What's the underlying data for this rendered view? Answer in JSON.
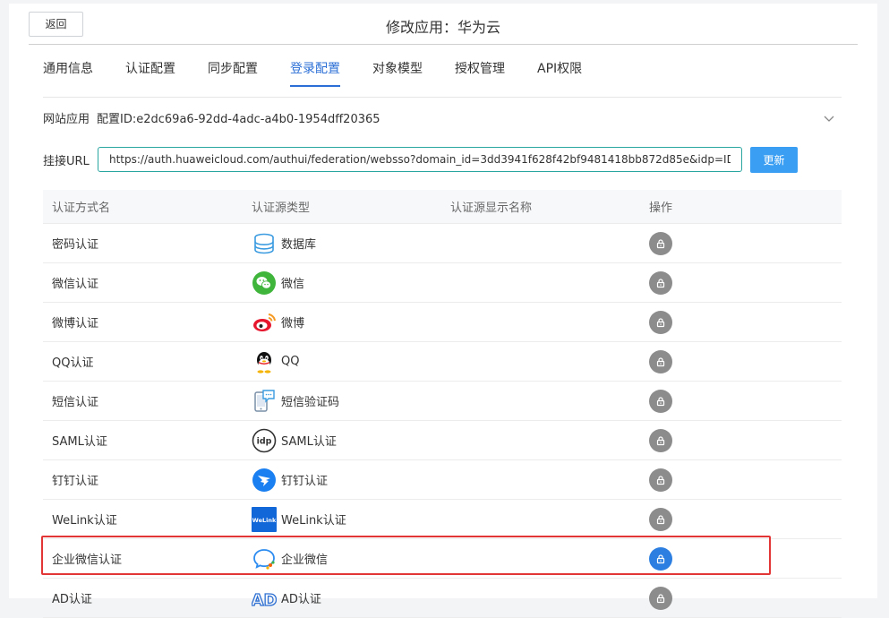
{
  "header": {
    "back_label": "返回",
    "title": "修改应用：华为云"
  },
  "tabs": [
    {
      "label": "通用信息",
      "active": false
    },
    {
      "label": "认证配置",
      "active": false
    },
    {
      "label": "同步配置",
      "active": false
    },
    {
      "label": "登录配置",
      "active": true
    },
    {
      "label": "对象模型",
      "active": false
    },
    {
      "label": "授权管理",
      "active": false
    },
    {
      "label": "API权限",
      "active": false
    }
  ],
  "app_info": {
    "type": "网站应用",
    "config_id": "配置ID:e2dc69a6-92dd-4adc-a4b0-1954dff20365"
  },
  "url": {
    "label": "挂接URL",
    "value": "https://auth.huaweicloud.com/authui/federation/websso?domain_id=3dd3941f628f42bf9481418bb872d85e&idp=IDASS",
    "update_label": "更新"
  },
  "table": {
    "headers": [
      "认证方式名",
      "认证源类型",
      "认证源显示名称",
      "操作"
    ],
    "rows": [
      {
        "name": "密码认证",
        "source": "数据库",
        "icon": "database-icon",
        "display": "",
        "enabled": false
      },
      {
        "name": "微信认证",
        "source": "微信",
        "icon": "wechat-icon",
        "display": "",
        "enabled": false
      },
      {
        "name": "微博认证",
        "source": "微博",
        "icon": "weibo-icon",
        "display": "",
        "enabled": false
      },
      {
        "name": "QQ认证",
        "source": "QQ",
        "icon": "qq-icon",
        "display": "",
        "enabled": false
      },
      {
        "name": "短信认证",
        "source": "短信验证码",
        "icon": "sms-icon",
        "display": "",
        "enabled": false
      },
      {
        "name": "SAML认证",
        "source": "SAML认证",
        "icon": "idp-icon",
        "display": "",
        "enabled": false
      },
      {
        "name": "钉钉认证",
        "source": "钉钉认证",
        "icon": "dingtalk-icon",
        "display": "",
        "enabled": false
      },
      {
        "name": "WeLink认证",
        "source": "WeLink认证",
        "icon": "welink-icon",
        "display": "",
        "enabled": false
      },
      {
        "name": "企业微信认证",
        "source": "企业微信",
        "icon": "wecom-icon",
        "display": "",
        "enabled": true
      },
      {
        "name": "AD认证",
        "source": "AD认证",
        "icon": "ad-icon",
        "display": "",
        "enabled": false
      }
    ]
  },
  "colors": {
    "accent": "#2b6fd6",
    "update_button": "#3a9ff2",
    "lock_off": "#8c8c8c",
    "lock_on": "#2c7fe0",
    "highlight": "#e23535"
  }
}
